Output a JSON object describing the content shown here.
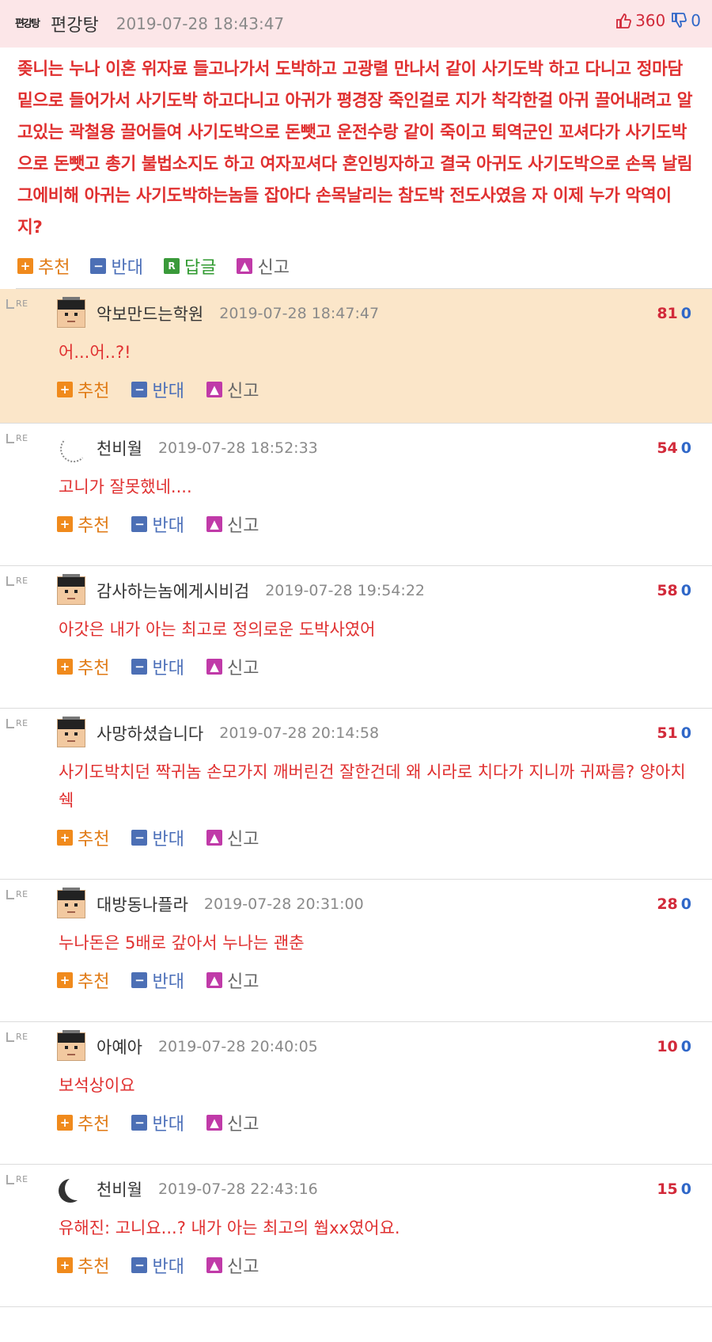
{
  "post": {
    "avatar_text": "편강탕",
    "author": "편강탕",
    "date": "2019-07-28 18:43:47",
    "upvotes": "360",
    "downvotes": "0",
    "body": "좆니는 누나 이혼 위자료 들고나가서 도박하고 고광렬 만나서 같이 사기도박 하고 다니고 정마담 밑으로 들어가서 사기도박 하고다니고 아귀가 평경장 죽인걸로 지가 착각한걸 아귀 끌어내려고 알고있는 곽철용 끌어들여 사기도박으로 돈뺏고 운전수랑 같이 죽이고 퇴역군인 꼬셔다가 사기도박으로 돈뺏고 총기 불법소지도 하고 여자꼬셔다 혼인빙자하고 결국 아귀도 사기도박으로 손목 날림 그에비해 아귀는 사기도박하는놈들 잡아다 손목날리는 참도박 전도사였음 자 이제 누가 악역이지?",
    "actions": {
      "recommend": "추천",
      "oppose": "반대",
      "reply": "답글",
      "report": "신고"
    }
  },
  "comments": [
    {
      "name": "악보만드는학원",
      "date": "2019-07-28 18:47:47",
      "up": "81",
      "down": "0",
      "text": "어...어..?!",
      "avatar": "pixel-face-icon",
      "highlight": true
    },
    {
      "name": "천비월",
      "date": "2019-07-28 18:52:33",
      "up": "54",
      "down": "0",
      "text": "고니가 잘못했네....",
      "avatar": "dotted-moon-icon",
      "highlight": false
    },
    {
      "name": "감사하는놈에게시비검",
      "date": "2019-07-28 19:54:22",
      "up": "58",
      "down": "0",
      "text": "아갓은 내가 아는 최고로 정의로운 도박사였어",
      "avatar": "pixel-face-icon",
      "highlight": false
    },
    {
      "name": "사망하셨습니다",
      "date": "2019-07-28 20:14:58",
      "up": "51",
      "down": "0",
      "text": "사기도박치던 짝귀놈 손모가지 깨버린건 잘한건데 왜 시라로 치다가 지니까 귀짜름? 양아치쉑",
      "avatar": "pixel-face-icon",
      "highlight": false
    },
    {
      "name": "대방동나플라",
      "date": "2019-07-28 20:31:00",
      "up": "28",
      "down": "0",
      "text": "누나돈은 5배로 갚아서 누나는 괜춘",
      "avatar": "pixel-face-icon",
      "highlight": false
    },
    {
      "name": "아예아",
      "date": "2019-07-28 20:40:05",
      "up": "10",
      "down": "0",
      "text": "보석상이요",
      "avatar": "pixel-face-icon",
      "highlight": false
    },
    {
      "name": "천비월",
      "date": "2019-07-28 22:43:16",
      "up": "15",
      "down": "0",
      "text": "유해진: 고니요...? 내가 아는 최고의 쒑xx였어요.",
      "avatar": "moon-icon",
      "highlight": false
    }
  ],
  "comment_actions": {
    "recommend": "추천",
    "oppose": "반대",
    "report": "신고"
  },
  "re_label": "RE",
  "colors": {
    "accent_red": "#e03030",
    "header_bg": "#fce6e8",
    "highlight_bg": "#fbe6c9",
    "recommend": "#f08a1c",
    "oppose": "#4c6fb5"
  }
}
